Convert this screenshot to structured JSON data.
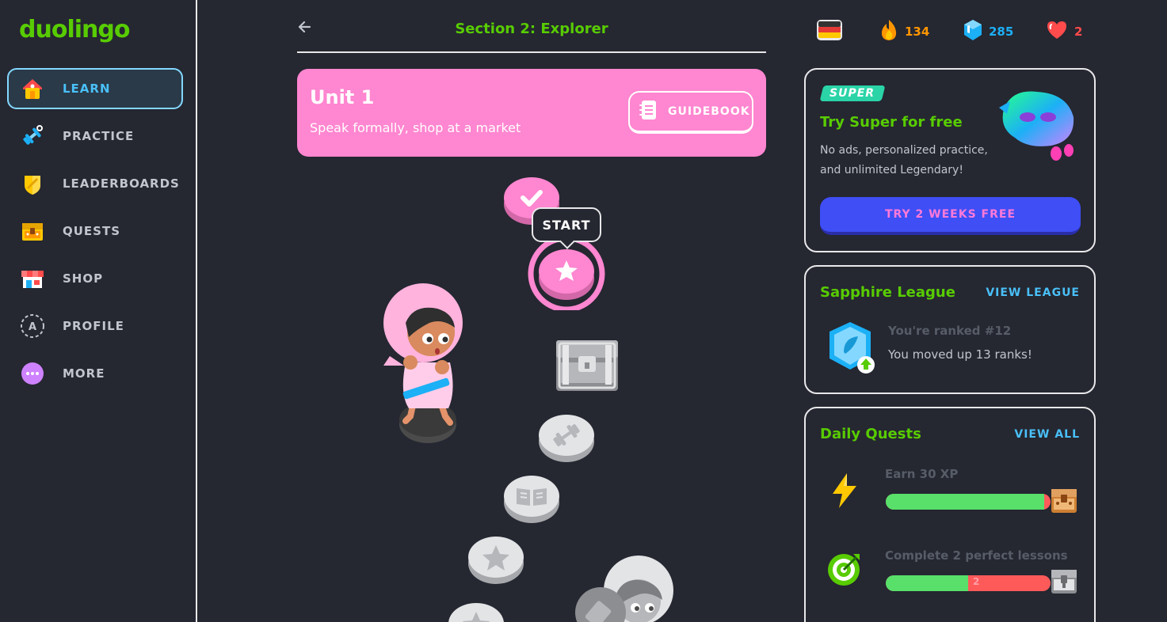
{
  "sidebar": {
    "logo": "duolingo",
    "items": [
      {
        "label": "LEARN",
        "icon": "home-icon"
      },
      {
        "label": "PRACTICE",
        "icon": "dumbbell-icon"
      },
      {
        "label": "LEADERBOARDS",
        "icon": "shield-icon"
      },
      {
        "label": "QUESTS",
        "icon": "chest-icon"
      },
      {
        "label": "SHOP",
        "icon": "shop-icon"
      },
      {
        "label": "PROFILE",
        "icon": "avatar-icon",
        "avatar_letter": "A"
      },
      {
        "label": "MORE",
        "icon": "more-icon"
      }
    ]
  },
  "main": {
    "section_title": "Section 2: Explorer",
    "back_icon": "arrow-left-icon",
    "unit": {
      "title": "Unit 1",
      "subtitle": "Speak formally, shop at a market",
      "guidebook_label": "GUIDEBOOK"
    },
    "path": {
      "start_label": "START"
    }
  },
  "topstats": {
    "language_flag": "german-flag-icon",
    "streak": "134",
    "gems": "285",
    "hearts": "2"
  },
  "super_card": {
    "badge": "SUPER",
    "title": "Try Super for free",
    "description": "No ads, personalized practice, and unlimited Legendary!",
    "button": "TRY 2 WEEKS FREE"
  },
  "league_card": {
    "title": "Sapphire League",
    "link": "VIEW LEAGUE",
    "rank": "You're ranked #12",
    "moved": "You moved up 13 ranks!"
  },
  "quests_card": {
    "title": "Daily Quests",
    "link": "VIEW ALL",
    "quests": [
      {
        "label": "Earn 30 XP",
        "progress_fraction": 0.96,
        "icon": "lightning-icon"
      },
      {
        "label": "Complete 2 perfect lessons",
        "progress_fraction": 0.5,
        "count_text": "2",
        "icon": "target-icon"
      }
    ]
  },
  "colors": {
    "green": "#58cc02",
    "blue": "#49c0f8",
    "pink": "#ff86d0",
    "background": "#252731"
  }
}
